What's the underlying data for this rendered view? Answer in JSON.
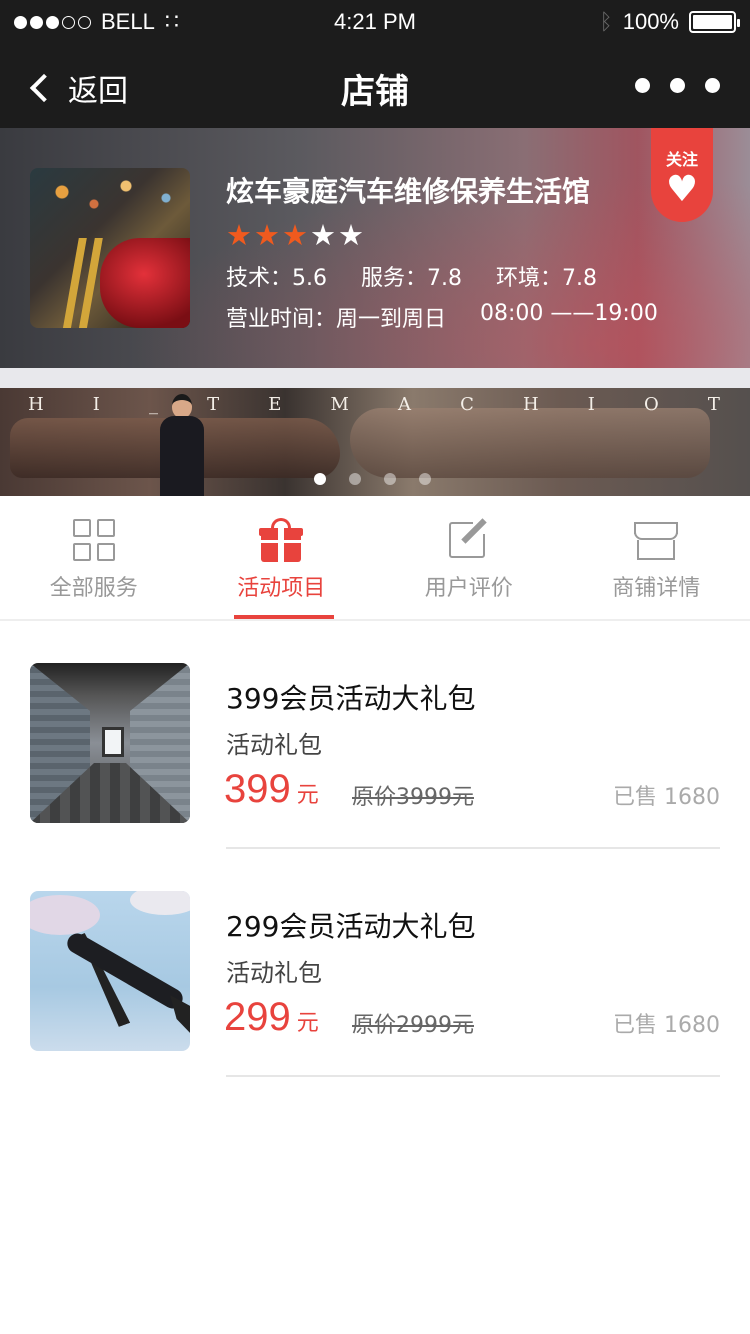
{
  "status_bar": {
    "carrier": "BELL",
    "time": "4:21 PM",
    "battery": "100%",
    "signal_bars_filled": 3,
    "signal_bars_total": 5
  },
  "nav": {
    "back_label": "返回",
    "title": "店铺"
  },
  "store": {
    "name": "炫车豪庭汽车维修保养生活馆",
    "rating": 3,
    "rating_max": 5,
    "scores": [
      {
        "label": "技术：",
        "value": "5.6"
      },
      {
        "label": "服务：",
        "value": "7.8"
      },
      {
        "label": "环境：",
        "value": "7.8"
      }
    ],
    "hours_label": "营业时间：周一到周日",
    "hours_value": "08:00 ——19:00",
    "follow_label": "关注"
  },
  "banner": {
    "letters": [
      "H",
      "I",
      "_",
      "T",
      "E",
      "M",
      "A",
      "C",
      "H",
      "I",
      "O",
      "T"
    ],
    "page_count": 4,
    "active_page": 1
  },
  "tabs": [
    {
      "label": "全部服务",
      "icon": "grid-icon"
    },
    {
      "label": "活动项目",
      "icon": "gift-icon",
      "active": true
    },
    {
      "label": "用户评价",
      "icon": "edit-icon"
    },
    {
      "label": "商铺详情",
      "icon": "shop-icon"
    }
  ],
  "products": [
    {
      "name": "399会员活动大礼包",
      "subtitle": "活动礼包",
      "price": "399",
      "price_unit": "元",
      "original_price": "原价3999元",
      "sold": "已售 1680"
    },
    {
      "name": "299会员活动大礼包",
      "subtitle": "活动礼包",
      "price": "299",
      "price_unit": "元",
      "original_price": "原价2999元",
      "sold": "已售 1680"
    }
  ],
  "colors": {
    "accent": "#e8433d",
    "star": "#f05a1e",
    "bar": "#1c1c1c"
  }
}
